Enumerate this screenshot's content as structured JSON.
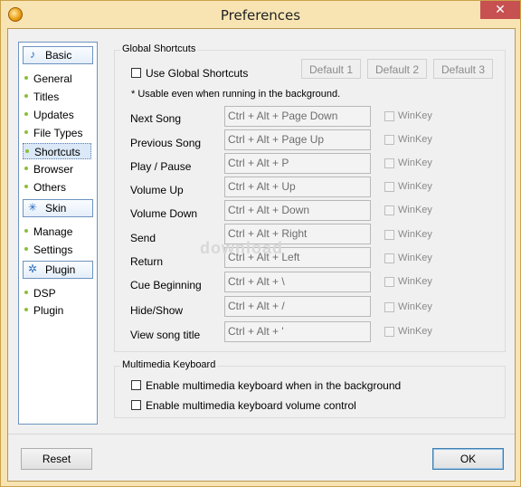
{
  "window": {
    "title": "Preferences",
    "close_glyph": "✕"
  },
  "nav": {
    "sections": [
      {
        "label": "Basic",
        "icon": "music-note-icon",
        "glyph": "♪",
        "items": [
          "General",
          "Titles",
          "Updates",
          "File Types",
          "Shortcuts",
          "Browser",
          "Others"
        ]
      },
      {
        "label": "Skin",
        "icon": "sparkle-icon",
        "glyph": "✳",
        "items": [
          "Manage",
          "Settings"
        ]
      },
      {
        "label": "Plugin",
        "icon": "gear-icon",
        "glyph": "✲",
        "items": [
          "DSP",
          "Plugin"
        ]
      }
    ],
    "selected": "Shortcuts"
  },
  "global_shortcuts": {
    "group_label": "Global Shortcuts",
    "use_label": "Use Global Shortcuts",
    "use_checked": false,
    "defaults": [
      "Default 1",
      "Default 2",
      "Default 3"
    ],
    "note": "* Usable even when running in the background.",
    "winkey_label": "WinKey",
    "rows": [
      {
        "action": "Next Song",
        "keys": "Ctrl + Alt + Page Down"
      },
      {
        "action": "Previous Song",
        "keys": "Ctrl + Alt + Page Up"
      },
      {
        "action": "Play / Pause",
        "keys": "Ctrl + Alt + P"
      },
      {
        "action": "Volume Up",
        "keys": "Ctrl + Alt + Up"
      },
      {
        "action": "Volume Down",
        "keys": "Ctrl + Alt + Down"
      },
      {
        "action": "Send",
        "keys": "Ctrl + Alt + Right"
      },
      {
        "action": "Return",
        "keys": "Ctrl + Alt + Left"
      },
      {
        "action": "Cue Beginning",
        "keys": "Ctrl + Alt + \\"
      },
      {
        "action": "Hide/Show",
        "keys": "Ctrl + Alt + /"
      },
      {
        "action": "View song title",
        "keys": "Ctrl + Alt + '"
      }
    ]
  },
  "multimedia": {
    "group_label": "Multimedia Keyboard",
    "options": [
      {
        "label": "Enable multimedia keyboard when in the background",
        "checked": false
      },
      {
        "label": "Enable multimedia keyboard volume control",
        "checked": false
      }
    ]
  },
  "footer": {
    "reset_label": "Reset",
    "ok_label": "OK"
  },
  "watermark": "download"
}
